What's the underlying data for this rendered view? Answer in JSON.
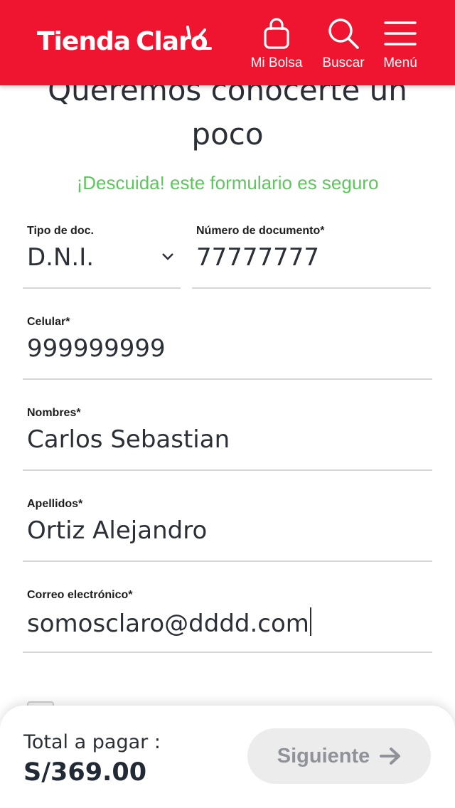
{
  "header": {
    "logo_tienda": "Tienda",
    "logo_claro": "Claro",
    "bag_label": "Mi Bolsa",
    "search_label": "Buscar",
    "menu_label": "Menú",
    "brand_color": "#ef1530"
  },
  "form": {
    "heading_line1": "Queremos conocerte un",
    "heading_line2": "poco",
    "secure_note": "¡Descuida! este formulario es seguro",
    "doc_type": {
      "label": "Tipo de doc.",
      "value": "D.N.I."
    },
    "doc_number": {
      "label": "Número de documento*",
      "value": "77777777"
    },
    "phone": {
      "label": "Celular*",
      "value": "999999999"
    },
    "first_names": {
      "label": "Nombres*",
      "value": "Carlos Sebastian"
    },
    "last_names": {
      "label": "Apellidos*",
      "value": "Ortiz Alejandro"
    },
    "email": {
      "label": "Correo electrónico*",
      "value": "somosclaro@dddd.com"
    }
  },
  "footer": {
    "total_label": "Total a pagar :",
    "total_amount": "S/369.00",
    "next_label": "Siguiente"
  },
  "icons": [
    "bag-icon",
    "search-icon",
    "menu-icon",
    "chevron-down-icon",
    "arrow-right-icon"
  ]
}
